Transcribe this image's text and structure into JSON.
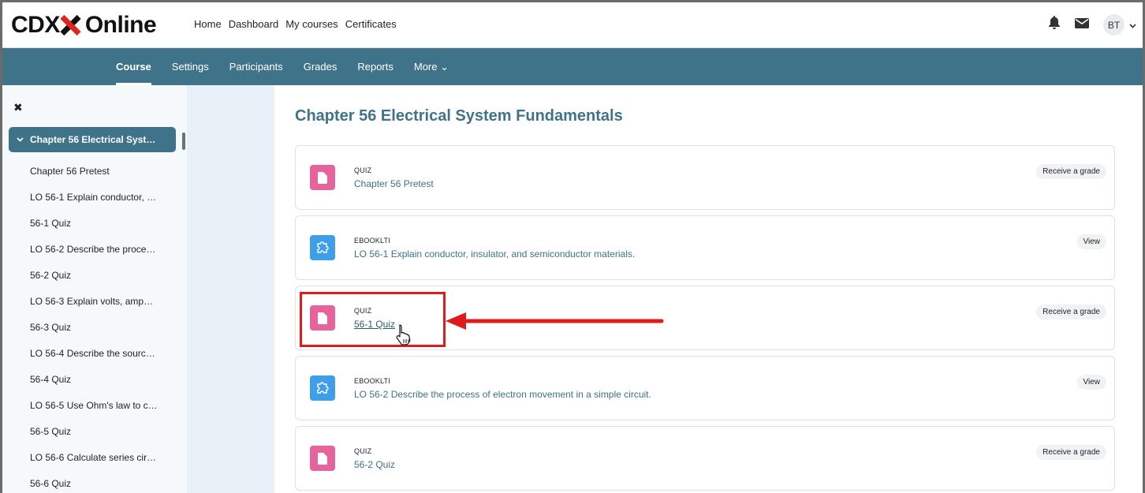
{
  "brand": {
    "logo_prefix": "CDX",
    "logo_suffix": "Online"
  },
  "top_nav": [
    "Home",
    "Dashboard",
    "My courses",
    "Certificates"
  ],
  "user": {
    "initials": "BT"
  },
  "secondary_nav": [
    {
      "label": "Course",
      "active": true
    },
    {
      "label": "Settings",
      "active": false
    },
    {
      "label": "Participants",
      "active": false
    },
    {
      "label": "Grades",
      "active": false
    },
    {
      "label": "Reports",
      "active": false
    },
    {
      "label": "More ⌄",
      "active": false
    }
  ],
  "drawer": {
    "close_symbol": "✖",
    "section_title": "Chapter 56 Electrical Syst…",
    "items": [
      "Chapter 56 Pretest",
      "LO 56-1 Explain conductor, …",
      "56-1 Quiz",
      "LO 56-2 Describe the proce…",
      "56-2 Quiz",
      "LO 56-3 Explain volts, amp…",
      "56-3 Quiz",
      "LO 56-4 Describe the sourc…",
      "56-4 Quiz",
      "LO 56-5 Use Ohm's law to c…",
      "56-5 Quiz",
      "LO 56-6 Calculate series cir…",
      "56-6 Quiz"
    ]
  },
  "main": {
    "page_title": "Chapter 56 Electrical System Fundamentals",
    "activities": [
      {
        "type": "QUIZ",
        "title": "Chapter 56 Pretest",
        "badge": "Receive a grade",
        "icon": "quiz-icon"
      },
      {
        "type": "EBOOKLTI",
        "title": "LO 56-1 Explain conductor, insulator, and semiconductor materials.",
        "badge": "View",
        "icon": "puzzle-icon"
      },
      {
        "type": "QUIZ",
        "title": "56-1 Quiz",
        "badge": "Receive a grade",
        "icon": "quiz-icon"
      },
      {
        "type": "EBOOKLTI",
        "title": "LO 56-2 Describe the process of electron movement in a simple circuit.",
        "badge": "View",
        "icon": "puzzle-icon"
      },
      {
        "type": "QUIZ",
        "title": "56-2 Quiz",
        "badge": "Receive a grade",
        "icon": "quiz-icon"
      }
    ]
  },
  "colors": {
    "brand_teal": "#3f7389",
    "quiz_pink": "#e8639c",
    "ebook_blue": "#3f9ee8",
    "annotation_red": "#e01b1b"
  }
}
